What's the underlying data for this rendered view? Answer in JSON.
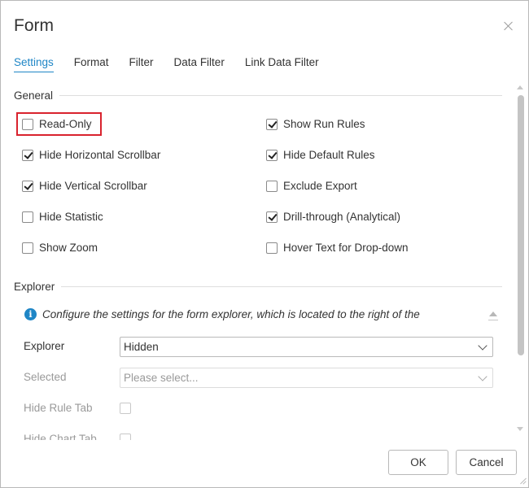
{
  "dialog": {
    "title": "Form"
  },
  "tabs": [
    {
      "label": "Settings",
      "active": true
    },
    {
      "label": "Format"
    },
    {
      "label": "Filter"
    },
    {
      "label": "Data Filter"
    },
    {
      "label": "Link Data Filter"
    }
  ],
  "general": {
    "heading": "General",
    "left": [
      {
        "label": "Read-Only",
        "checked": false,
        "highlighted": true
      },
      {
        "label": "Hide Horizontal Scrollbar",
        "checked": true
      },
      {
        "label": "Hide Vertical Scrollbar",
        "checked": true
      },
      {
        "label": "Hide Statistic",
        "checked": false
      },
      {
        "label": "Show Zoom",
        "checked": false
      }
    ],
    "right": [
      {
        "label": "Show Run Rules",
        "checked": true
      },
      {
        "label": "Hide Default Rules",
        "checked": true
      },
      {
        "label": "Exclude Export",
        "checked": false
      },
      {
        "label": "Drill-through (Analytical)",
        "checked": true
      },
      {
        "label": "Hover Text for Drop-down",
        "checked": false
      }
    ]
  },
  "explorer": {
    "heading": "Explorer",
    "info_text": "Configure the settings for the form explorer, which is located to the right of the",
    "explorer_label": "Explorer",
    "explorer_value": "Hidden",
    "selected_label": "Selected",
    "selected_placeholder": "Please select...",
    "hide_rule_tab_label": "Hide Rule Tab",
    "hide_chart_tab_label": "Hide Chart Tab"
  },
  "footer": {
    "ok_label": "OK",
    "cancel_label": "Cancel"
  },
  "colors": {
    "accent": "#1f86c6",
    "highlight_border": "#d9232e"
  }
}
